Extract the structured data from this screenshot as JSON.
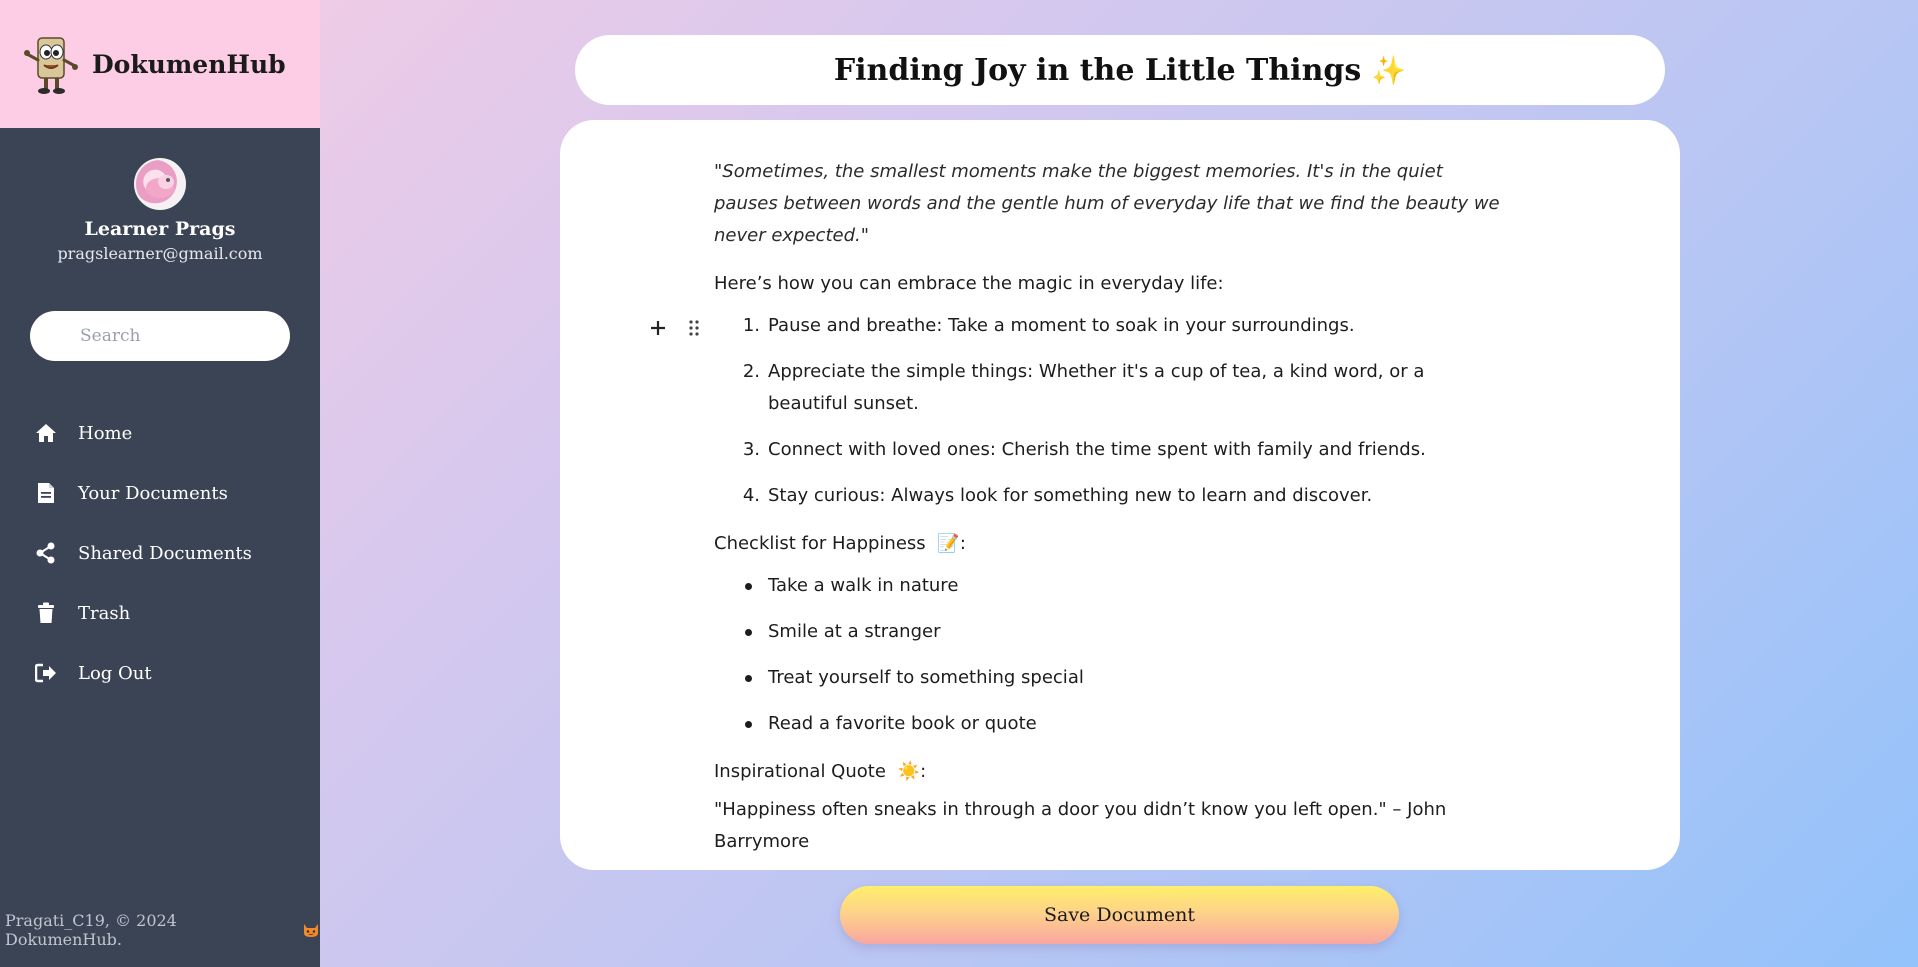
{
  "brand": {
    "name": "DokumenHub"
  },
  "profile": {
    "name": "Learner Prags",
    "email": "pragslearner@gmail.com"
  },
  "search": {
    "placeholder": "Search"
  },
  "nav": [
    {
      "label": "Home",
      "icon": "home-icon"
    },
    {
      "label": "Your Documents",
      "icon": "document-icon"
    },
    {
      "label": "Shared Documents",
      "icon": "share-icon"
    },
    {
      "label": "Trash",
      "icon": "trash-icon"
    },
    {
      "label": "Log Out",
      "icon": "logout-icon"
    }
  ],
  "footer": {
    "text": "Pragati_C19, © 2024 DokumenHub."
  },
  "document": {
    "title": "Finding Joy in the Little Things",
    "title_emoji": "✨",
    "intro_quote": "\"Sometimes, the smallest moments make the biggest memories. It's in the quiet pauses between words and the gentle hum of everyday life that we find the beauty we never expected.\"",
    "how_to": "Here’s how you can embrace the magic in everyday life:",
    "steps": [
      {
        "num": "1.",
        "text": "Pause and breathe: Take a moment to soak in your surroundings."
      },
      {
        "num": "2.",
        "text": "Appreciate the simple things: Whether it's a cup of tea, a kind word, or a beautiful sunset."
      },
      {
        "num": "3.",
        "text": "Connect with loved ones: Cherish the time spent with family and friends."
      },
      {
        "num": "4.",
        "text": "Stay curious: Always look for something new to learn and discover."
      }
    ],
    "checklist_heading": "Checklist for Happiness",
    "checklist_emoji": "📝",
    "checklist": [
      "Take a walk in nature",
      "Smile at a stranger",
      "Treat yourself to something special",
      "Read a favorite book or quote"
    ],
    "quote_heading": "Inspirational Quote",
    "quote_emoji": "☀️",
    "final_quote": "\"Happiness often sneaks in through a door you didn’t know you left open.\" – John Barrymore"
  },
  "actions": {
    "save_label": "Save Document"
  },
  "colors": {
    "sidebar_bg": "#3b4454",
    "brand_bg": "#fccde4",
    "save_gradient_top": "#ffef6a",
    "save_gradient_bottom": "#faa6a0"
  }
}
